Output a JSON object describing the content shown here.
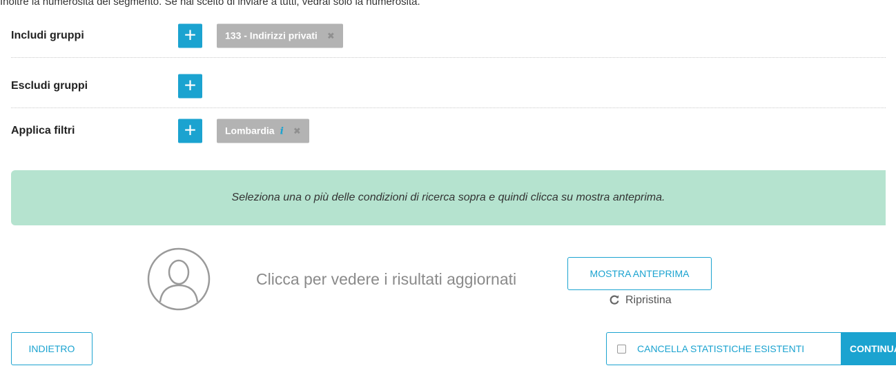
{
  "header": {
    "note": "Inoltre la numerosità del segmento. Se hai scelto di inviare a tutti, vedrai solo la numerosità."
  },
  "rows": {
    "include": {
      "label": "Includi gruppi",
      "tags": [
        "133 - Indirizzi privati"
      ]
    },
    "exclude": {
      "label": "Escludi gruppi",
      "tags": []
    },
    "filters": {
      "label": "Applica filtri",
      "tags": [
        "Lombardia"
      ]
    }
  },
  "add_label": "+",
  "info_glyph": "i",
  "remove_glyph": "✖",
  "banner": {
    "text": "Seleziona una o più delle condizioni di ricerca sopra e quindi clicca su mostra anteprima."
  },
  "preview": {
    "text": "Clicca per vedere i risultati aggiornati",
    "button_label": "MOSTRA ANTEPRIMA",
    "reset_label": "Ripristina"
  },
  "footer": {
    "back_label": "INDIETRO",
    "clear_stats_label": "CANCELLA STATISTICHE ESISTENTI",
    "clear_stats_checked": false,
    "continue_label": "CONTINUA"
  },
  "colors": {
    "accent": "#1ba3d0",
    "tag_bg": "#b3b3b3",
    "banner_bg": "#b5e3cf"
  }
}
